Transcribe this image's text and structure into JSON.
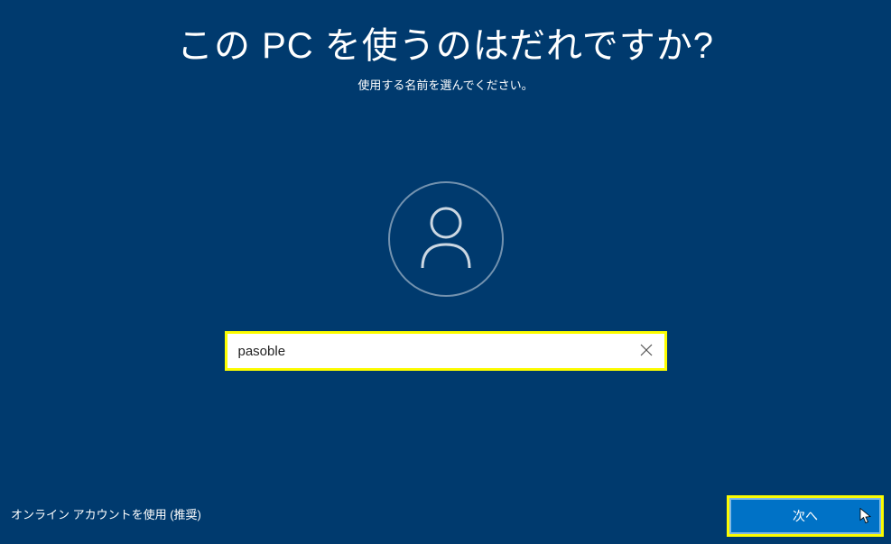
{
  "header": {
    "title": "この PC を使うのはだれですか?",
    "subtitle": "使用する名前を選んでください。"
  },
  "form": {
    "username_value": "pasoble"
  },
  "footer": {
    "online_account_link": "オンライン アカウントを使用 (推奨)",
    "next_button_label": "次へ"
  }
}
